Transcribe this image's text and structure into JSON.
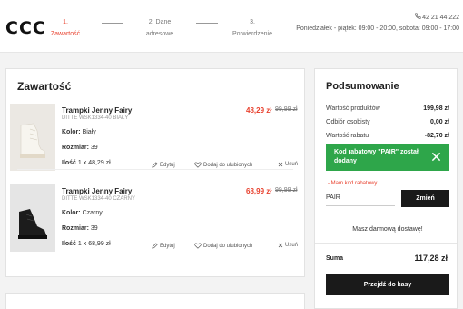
{
  "header": {
    "logo": "ccc",
    "steps": [
      {
        "num": "1.",
        "label": "Zawartość"
      },
      {
        "num": "2. Dane",
        "label": "adresowe"
      },
      {
        "num": "3.",
        "label": "Potwierdzenie"
      }
    ],
    "phone": "42 21 44 222",
    "hours": "Poniedziałek - piątek: 09:00 - 20:00, sobota: 09:00 - 17:00"
  },
  "cart": {
    "title": "Zawartość",
    "labels": {
      "color": "Kolor:",
      "size": "Rozmiar:",
      "qty": "Ilość",
      "edit": "Edytuj",
      "favorite": "Dodaj do ulubionych",
      "remove": "Usuń"
    },
    "items": [
      {
        "name": "Trampki Jenny Fairy",
        "sku": "DITTE WSK1334-40 BIAŁY",
        "color": "Biały",
        "size": "39",
        "qty": "1 x 48,29 zł",
        "price": "48,29 zł",
        "old_price": "99,99 zł"
      },
      {
        "name": "Trampki Jenny Fairy",
        "sku": "DITTE WSK1334-40 CZARNY",
        "color": "Czarny",
        "size": "39",
        "qty": "1 x 68,99 zł",
        "price": "68,99 zł",
        "old_price": "99,99 zł"
      }
    ]
  },
  "summary": {
    "title": "Podsumowanie",
    "rows": [
      {
        "label": "Wartość produktów",
        "value": "199,98 zł"
      },
      {
        "label": "Odbiór osobisty",
        "value": "0,00 zł"
      },
      {
        "label": "Wartość rabatu",
        "value": "-82,70 zł"
      }
    ],
    "promo_message": "Kod rabatowy \"PAIR\" został dodany",
    "have_code": "Mam kod rabatowy",
    "code_value": "PAIR",
    "apply_label": "Zmień",
    "free_shipping": "Masz darmową dostawę!",
    "total_label": "Suma",
    "total_value": "117,28 zł",
    "checkout_label": "Przejdź do kasy"
  },
  "colors": {
    "accent": "#e8412e",
    "success": "#2ea64a",
    "dark": "#1a1a1a"
  }
}
